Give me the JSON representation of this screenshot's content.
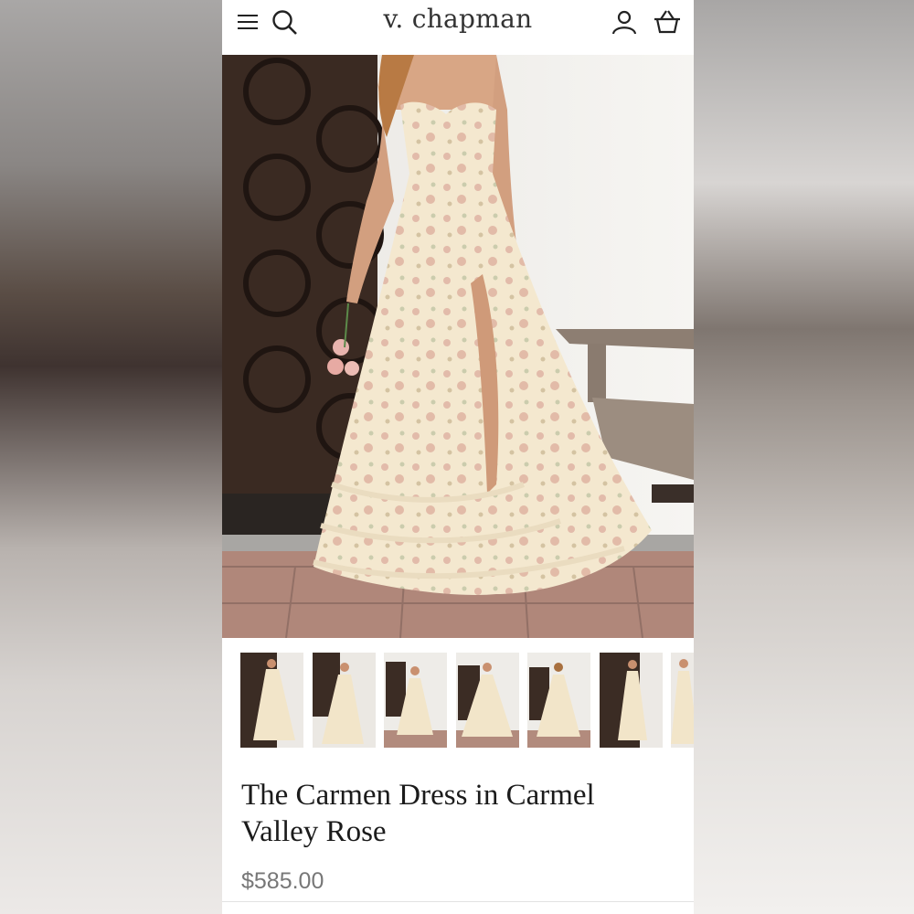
{
  "header": {
    "brand": "v. chapman",
    "menu_icon": "hamburger-menu-icon",
    "search_icon": "search-icon",
    "account_icon": "user-account-icon",
    "cart_icon": "basket-icon"
  },
  "hero": {
    "subject": "floral ruffled maxi dress"
  },
  "thumbnails": [
    {
      "label": "thumbnail-1"
    },
    {
      "label": "thumbnail-2"
    },
    {
      "label": "thumbnail-3"
    },
    {
      "label": "thumbnail-4"
    },
    {
      "label": "thumbnail-5"
    },
    {
      "label": "thumbnail-6"
    },
    {
      "label": "thumbnail-7"
    }
  ],
  "product": {
    "title": "The Carmen Dress in Carmel Valley Rose",
    "price": "$585.00"
  },
  "colors": {
    "text": "#1b1b1b",
    "price": "#777777",
    "dress": "#f3e6cc",
    "door": "#3a2a22"
  }
}
